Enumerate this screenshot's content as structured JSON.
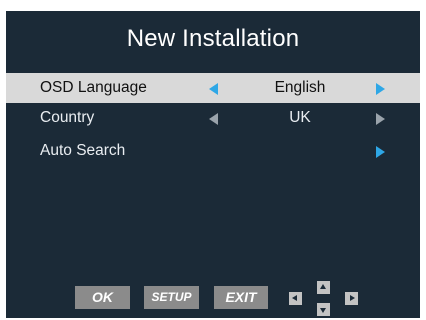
{
  "title": "New Installation",
  "menu": {
    "items": [
      {
        "label": "OSD Language",
        "value": "English",
        "selected": true
      },
      {
        "label": "Country",
        "value": "UK",
        "selected": false
      },
      {
        "label": "Auto Search",
        "value": "",
        "selected": false
      }
    ]
  },
  "keys": {
    "ok": "OK",
    "setup": "SETUP",
    "exit": "EXIT"
  },
  "colors": {
    "background": "#1b2a37",
    "highlight": "#d9d9d9",
    "accent": "#2ea7e6"
  }
}
